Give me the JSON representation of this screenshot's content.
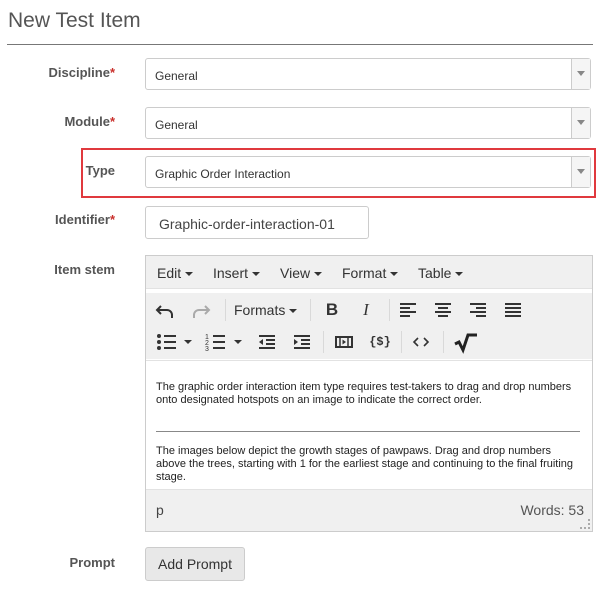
{
  "page": {
    "title": "New Test Item"
  },
  "form": {
    "discipline": {
      "label": "Discipline",
      "required": "*",
      "value": "General"
    },
    "module": {
      "label": "Module",
      "required": "*",
      "value": "General"
    },
    "type": {
      "label": "Type",
      "value": "Graphic Order Interaction"
    },
    "identifier": {
      "label": "Identifier",
      "required": "*",
      "value": "Graphic-order-interaction-01"
    },
    "item_stem": {
      "label": "Item stem"
    },
    "prompt": {
      "label": "Prompt",
      "button": "Add Prompt"
    }
  },
  "editor": {
    "menus": [
      "Edit",
      "Insert",
      "View",
      "Format",
      "Table"
    ],
    "toolbar": {
      "formats_label": "Formats",
      "icons": [
        "undo-icon",
        "redo-icon",
        "bold-icon",
        "italic-icon",
        "align-left-icon",
        "align-center-icon",
        "align-right-icon",
        "align-justify-icon",
        "bullet-list-icon",
        "numbered-list-icon",
        "outdent-icon",
        "indent-icon",
        "media-icon",
        "template-icon",
        "code-icon",
        "math-icon"
      ]
    },
    "content": {
      "paragraph1": "The graphic order interaction item type requires test-takers to drag and drop numbers onto designated hotspots on an image to indicate the correct order.",
      "paragraph2": "The images below depict the growth stages of pawpaws. Drag and drop numbers above the trees, starting with 1 for the earliest stage and continuing to the final fruiting stage."
    },
    "status": {
      "path": "p",
      "word_count": "Words: 53"
    }
  },
  "colors": {
    "required": "#c9302c",
    "highlight": "#e0393e"
  }
}
